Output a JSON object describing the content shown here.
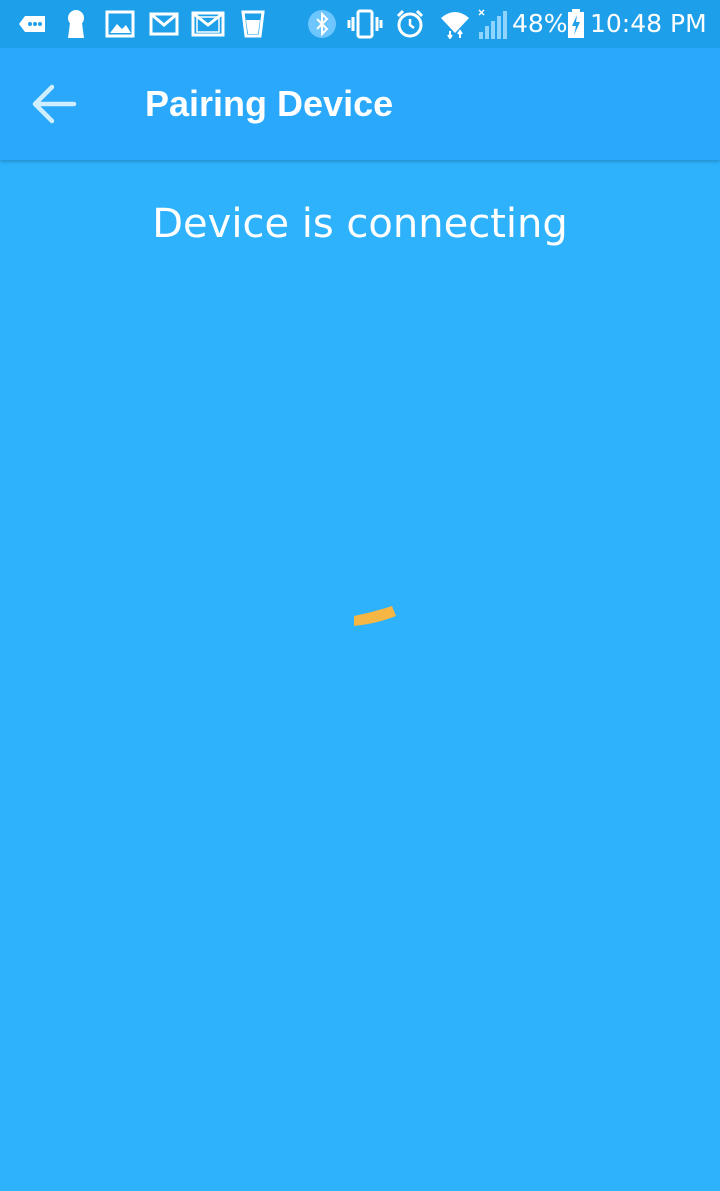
{
  "status_bar": {
    "battery_percent": "48%",
    "time": "10:48 PM",
    "left_icons": [
      "chat-bubble-icon",
      "keyhole-icon",
      "image-icon",
      "gmail-icon",
      "gmail-icon",
      "glass-icon"
    ],
    "right_icons": [
      "bluetooth-icon",
      "vibrate-icon",
      "alarm-icon",
      "wifi-icon",
      "signal-icon",
      "battery-charging-icon"
    ]
  },
  "app_bar": {
    "title": "Pairing Device",
    "back_icon": "arrow-left-icon"
  },
  "main": {
    "status_message": "Device is connecting",
    "spinner_color": "#f5b643"
  },
  "colors": {
    "background": "#2eb2fc",
    "app_bar": "#2aa8fb",
    "status_bar": "#1e9fea"
  }
}
